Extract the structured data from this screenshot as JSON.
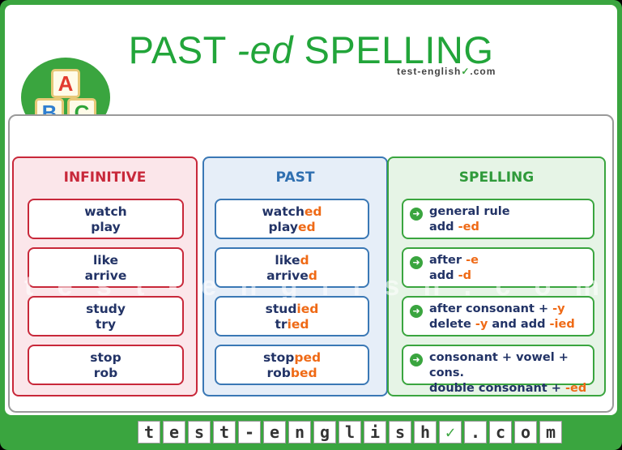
{
  "title": {
    "pre": "PAST ",
    "italic": "-ed",
    "post": " SPELLING"
  },
  "brand": {
    "text": "test-english",
    "suffix": ".com"
  },
  "logo": {
    "letters": [
      "A",
      "B",
      "C"
    ],
    "colors": [
      "#e23b2f",
      "#2f7fd0",
      "#2fa53a"
    ]
  },
  "columns": {
    "infinitive": {
      "header": "INFINITIVE",
      "items": [
        [
          "watch",
          "play"
        ],
        [
          "like",
          "arrive"
        ],
        [
          "study",
          "try"
        ],
        [
          "stop",
          "rob"
        ]
      ]
    },
    "past": {
      "header": "PAST",
      "items": [
        [
          [
            "watch",
            "ed"
          ],
          [
            "play",
            "ed"
          ]
        ],
        [
          [
            "like",
            "d"
          ],
          [
            "arrive",
            "d"
          ]
        ],
        [
          [
            "stud",
            "ied"
          ],
          [
            "tr",
            "ied"
          ]
        ],
        [
          [
            "stop",
            "ped"
          ],
          [
            "rob",
            "bed"
          ]
        ]
      ]
    },
    "spelling": {
      "header": "SPELLING",
      "items": [
        {
          "line1": [
            "general rule",
            ""
          ],
          "line2": [
            "add ",
            "-ed"
          ]
        },
        {
          "line1": [
            "after ",
            "-e"
          ],
          "line2": [
            "add ",
            "-d"
          ]
        },
        {
          "line1": [
            "after consonant + ",
            "-y"
          ],
          "line2": [
            "delete ",
            "-y",
            " and add ",
            "-ied"
          ]
        },
        {
          "line1": [
            "consonant + vowel + cons.",
            ""
          ],
          "line2": [
            "double consonant + ",
            "-ed"
          ]
        }
      ]
    }
  },
  "watermark": "test-english.com",
  "footer": [
    "t",
    "e",
    "s",
    "t",
    "-",
    "e",
    "n",
    "g",
    "l",
    "i",
    "s",
    "h",
    "✓",
    ".",
    "c",
    "o",
    "m"
  ],
  "colors": {
    "green": "#3aa53f",
    "red": "#c8283a",
    "blue": "#3a78b5",
    "orange": "#ef6a16",
    "navy": "#223366"
  }
}
